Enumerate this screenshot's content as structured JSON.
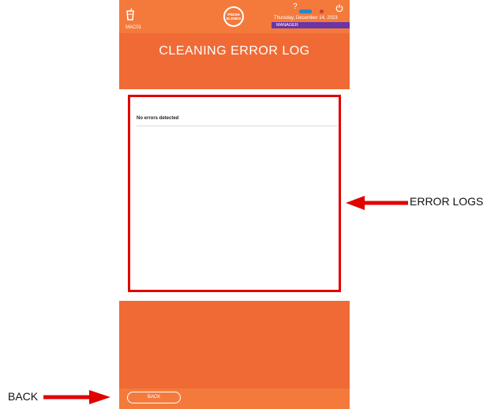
{
  "header": {
    "machine_id": "MAC01",
    "logo_text": "FRESH BLENDS",
    "help": "?",
    "datetime": "Thursday, December 14, 2023",
    "role": "MANAGER"
  },
  "page": {
    "title": "CLEANING ERROR LOG"
  },
  "log": {
    "empty_message": "No errors detected"
  },
  "footer": {
    "back_label": "BACK"
  },
  "annotations": {
    "error_logs": "ERROR LOGS",
    "back": "BACK",
    "highlight_color": "#e00000"
  },
  "colors": {
    "screen_background": "#f06a35",
    "header_background": "#f47a3c",
    "role_badge": "#6a35a5",
    "battery": "#2a88c7"
  }
}
